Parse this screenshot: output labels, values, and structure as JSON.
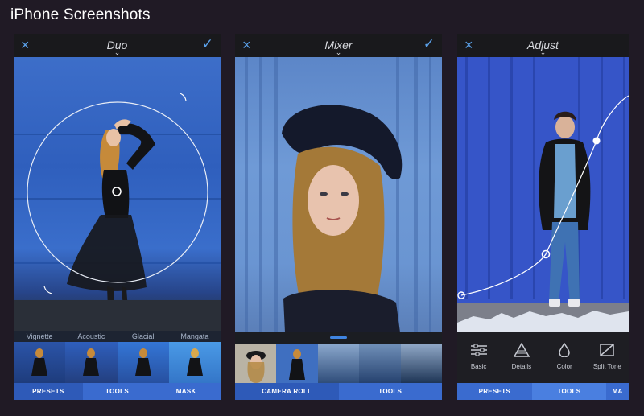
{
  "page": {
    "title": "iPhone Screenshots"
  },
  "screens": [
    {
      "title": "Duo",
      "close_icon": "×",
      "confirm_icon": "✓",
      "chevron": "⌄",
      "presets": [
        "Vignette",
        "Acoustic",
        "Glacial",
        "Mangata"
      ],
      "tabs": [
        "PRESETS",
        "TOOLS",
        "MASK"
      ]
    },
    {
      "title": "Mixer",
      "close_icon": "×",
      "confirm_icon": "✓",
      "chevron": "⌄",
      "tabs": [
        "CAMERA ROLL",
        "TOOLS"
      ]
    },
    {
      "title": "Adjust",
      "close_icon": "×",
      "chevron": "⌄",
      "tools": [
        {
          "label": "Basic",
          "icon": "sliders-icon"
        },
        {
          "label": "Details",
          "icon": "triangle-icon"
        },
        {
          "label": "Color",
          "icon": "droplet-icon"
        },
        {
          "label": "Split Tone",
          "icon": "split-tone-icon"
        }
      ],
      "tabs": [
        "PRESETS",
        "TOOLS",
        "MA"
      ]
    }
  ],
  "colors": {
    "accent": "#3a6bcf",
    "background": "#201a25"
  }
}
